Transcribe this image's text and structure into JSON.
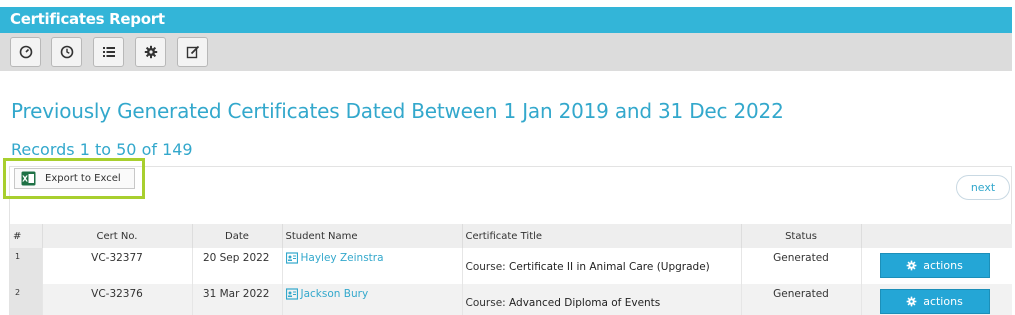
{
  "window": {
    "title": "Certificates Report"
  },
  "toolbar": {
    "buttons": [
      {
        "icon": "dashboard-icon"
      },
      {
        "icon": "clock-icon"
      },
      {
        "icon": "list-icon"
      },
      {
        "icon": "gear-icon"
      },
      {
        "icon": "edit-icon"
      }
    ]
  },
  "heading": "Previously Generated Certificates Dated Between 1 Jan 2019 and 31 Dec 2022",
  "records": "Records 1 to 50 of 149",
  "export": {
    "label": "Export to Excel",
    "highlight_color": "#a8cf2e"
  },
  "pager": {
    "next_label": "next"
  },
  "table": {
    "headers": {
      "num": "#",
      "cert_no": "Cert No.",
      "date": "Date",
      "student": "Student Name",
      "title": "Certificate Title",
      "status": "Status",
      "actions": ""
    },
    "rows": [
      {
        "num": "1",
        "cert_no": "VC-32377",
        "date": "20 Sep 2022",
        "student": "Hayley Zeinstra",
        "course_prefix": "Course:",
        "course_name": "Certificate II in Animal Care (Upgrade)",
        "status": "Generated",
        "action_label": "actions"
      },
      {
        "num": "2",
        "cert_no": "VC-32376",
        "date": "31 Mar 2022",
        "student": "Jackson Bury",
        "course_prefix": "Course:",
        "course_name": "Advanced Diploma of Events",
        "status": "Generated",
        "action_label": "actions"
      }
    ]
  },
  "colors": {
    "accent": "#33b5d8",
    "link": "#33a8cc",
    "action_button": "#24a6d6"
  }
}
